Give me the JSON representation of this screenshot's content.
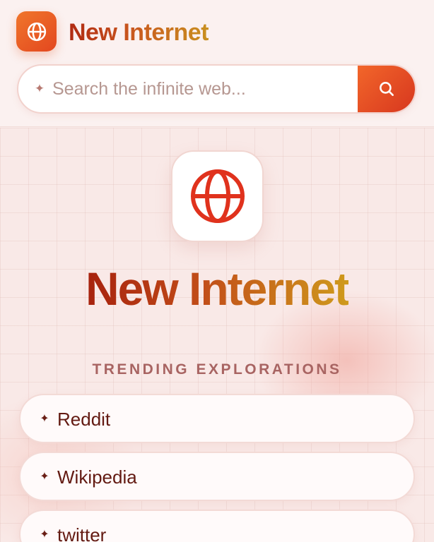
{
  "header": {
    "brand_title": "New Internet",
    "logo_icon": "globe-icon"
  },
  "search": {
    "placeholder": "Search the infinite web...",
    "value": "",
    "sparkle_icon": "sparkle-icon",
    "button_icon": "search-icon"
  },
  "hero": {
    "icon": "globe-icon",
    "title": "New Internet"
  },
  "trending": {
    "heading": "TRENDING EXPLORATIONS",
    "items": [
      {
        "label": "Reddit",
        "icon": "sparkle-icon"
      },
      {
        "label": "Wikipedia",
        "icon": "sparkle-icon"
      },
      {
        "label": "twitter",
        "icon": "sparkle-icon"
      }
    ]
  },
  "colors": {
    "accent": "#e3471f",
    "accent_light": "#f0762c",
    "title_gradient_start": "#a7220e",
    "title_gradient_end": "#cf9a1c",
    "text_dark": "#631a12",
    "heading_muted": "#a86462",
    "background": "#f9e9e7"
  }
}
